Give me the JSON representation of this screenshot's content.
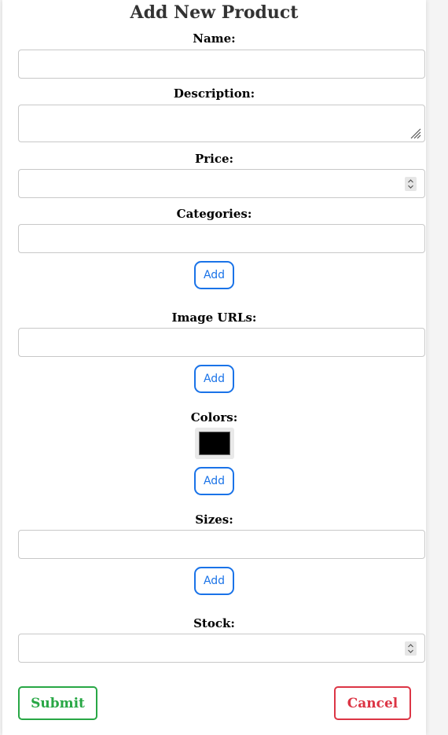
{
  "form": {
    "title": "Add New Product",
    "name": {
      "label": "Name:",
      "value": ""
    },
    "description": {
      "label": "Description:",
      "value": ""
    },
    "price": {
      "label": "Price:",
      "value": ""
    },
    "categories": {
      "label": "Categories:",
      "value": "",
      "add_label": "Add"
    },
    "image_urls": {
      "label": "Image URLs:",
      "value": "",
      "add_label": "Add"
    },
    "colors": {
      "label": "Colors:",
      "swatch_color": "#000000",
      "add_label": "Add"
    },
    "sizes": {
      "label": "Sizes:",
      "value": "",
      "add_label": "Add"
    },
    "stock": {
      "label": "Stock:",
      "value": ""
    },
    "submit_label": "Submit",
    "cancel_label": "Cancel"
  },
  "colors": {
    "primary": "#1a73e8",
    "success": "#28a745",
    "danger": "#dc3545"
  }
}
